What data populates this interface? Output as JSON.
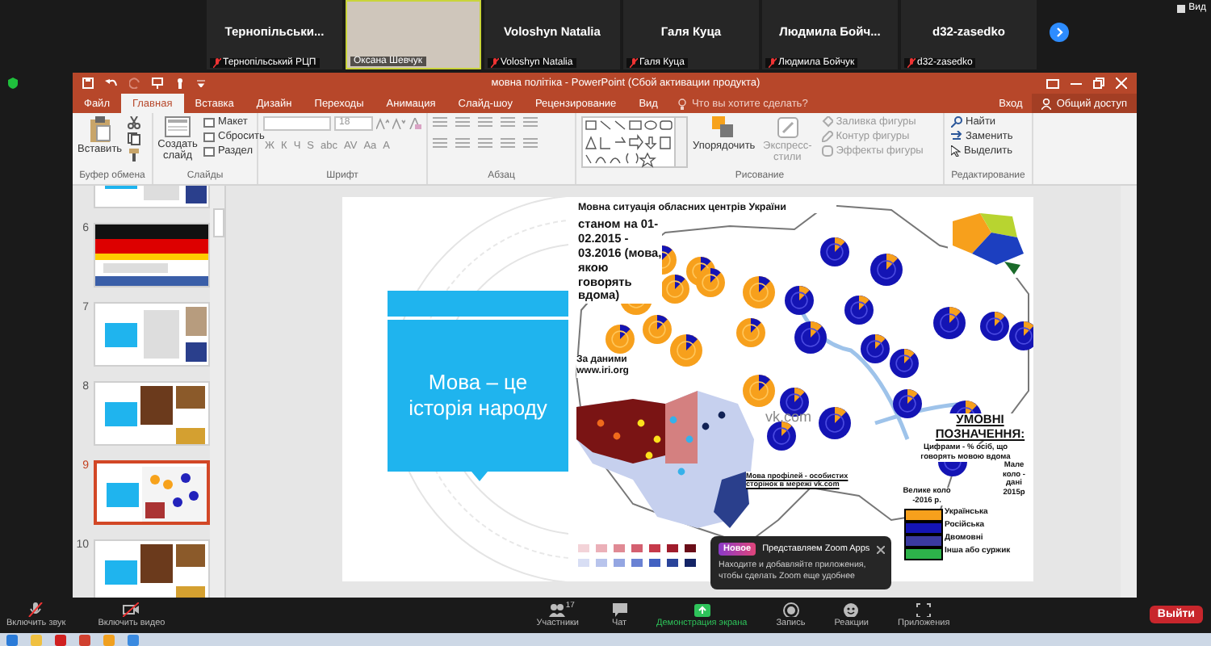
{
  "gallery": {
    "tiles": [
      {
        "kind": "name",
        "name": "Тернопільськи...",
        "label": "Тернопільський РЦП",
        "muted": true,
        "speaking": false
      },
      {
        "kind": "video",
        "label": "Оксана Шевчук",
        "muted": false,
        "speaking": true
      },
      {
        "kind": "name",
        "name": "Voloshyn Natalia",
        "label": "Voloshyn Natalia",
        "muted": true,
        "speaking": false
      },
      {
        "kind": "name",
        "name": "Галя  Куца",
        "label": "Галя Куца",
        "muted": true,
        "speaking": false
      },
      {
        "kind": "name",
        "name": "Людмила  Бойч...",
        "label": "Людмила Бойчук",
        "muted": true,
        "speaking": false
      },
      {
        "kind": "name",
        "name": "d32-zasedko",
        "label": "d32-zasedko",
        "muted": true,
        "speaking": false
      }
    ],
    "view_button": "Вид"
  },
  "app": {
    "title": "мовна політіка - PowerPoint (Сбой активации продукта)",
    "tabs": [
      {
        "label": "Файл",
        "selected": false
      },
      {
        "label": "Главная",
        "selected": true
      },
      {
        "label": "Вставка",
        "selected": false
      },
      {
        "label": "Дизайн",
        "selected": false
      },
      {
        "label": "Переходы",
        "selected": false
      },
      {
        "label": "Анимация",
        "selected": false
      },
      {
        "label": "Слайд-шоу",
        "selected": false
      },
      {
        "label": "Рецензирование",
        "selected": false
      },
      {
        "label": "Вид",
        "selected": false
      }
    ],
    "tell_me": "Что вы хотите сделать?",
    "sign_in": "Вход",
    "share": "Общий доступ",
    "ribbon": {
      "clipboard": {
        "label": "Буфер обмена",
        "paste": "Вставить"
      },
      "slides": {
        "label": "Слайды",
        "new_slide": "Создать слайд",
        "layout": "Макет",
        "reset": "Сбросить",
        "section": "Раздел"
      },
      "font": {
        "label": "Шрифт",
        "size": "18",
        "formats": [
          "Ж",
          "К",
          "Ч",
          "S",
          "abc",
          "AV",
          "Aa",
          "A"
        ]
      },
      "paragraph": {
        "label": "Абзац"
      },
      "drawing": {
        "label": "Рисование",
        "arrange": "Упорядочить",
        "styles": "Экспресс-стили",
        "fill": "Заливка фигуры",
        "outline": "Контур фигуры",
        "effects": "Эффекты фигуры"
      },
      "editing": {
        "label": "Редактирование",
        "find": "Найти",
        "replace": "Заменить",
        "select": "Выделить"
      }
    },
    "slides": [
      {
        "number": "6",
        "selected": false,
        "kind": "flag"
      },
      {
        "number": "7",
        "selected": false,
        "kind": "text"
      },
      {
        "number": "8",
        "selected": false,
        "kind": "photo"
      },
      {
        "number": "9",
        "selected": true,
        "kind": "map"
      },
      {
        "number": "10",
        "selected": false,
        "kind": "photo"
      }
    ],
    "slide": {
      "callout": "Мова – це історія народу",
      "map": {
        "title": "Мовна ситуація обласних центрів України",
        "subtitle": "станом на 01-02.2015 - 03.2016 (мова, якою говорять вдома)",
        "source": "За даними www.iri.org",
        "vk": "vk.com",
        "vk_note": "Мова профілей - особистих сторінок в мережі vk.com",
        "legend_title": "УМОВНІ ПОЗНАЧЕННЯ:",
        "legend_note": "Цифрами - % осіб, що говорять мовою вдома",
        "small_circle": "Мале коло - дані 2015р",
        "big_circle": "Велике коло -2016 р.",
        "legend": [
          {
            "label": "Українська",
            "color": "#f7a01c"
          },
          {
            "label": "Російська",
            "color": "#1414b4"
          },
          {
            "label": "Двомовні",
            "color": "#3a3aa0"
          },
          {
            "label": "Інша або суржик",
            "color": "#2db34a"
          }
        ]
      }
    }
  },
  "popup": {
    "badge": "Новое",
    "title": "Представляем Zoom Apps",
    "body": "Находите и добавляйте приложения, чтобы сделать Zoom еще удобнее"
  },
  "toolbar": {
    "items": [
      {
        "kind": "mic",
        "label": "Включить звук"
      },
      {
        "kind": "video",
        "label": "Включить видео"
      },
      {
        "kind": "participants",
        "label": "Участники",
        "count": "17"
      },
      {
        "kind": "chat",
        "label": "Чат"
      },
      {
        "kind": "share",
        "label": "Демонстрация экрана"
      },
      {
        "kind": "record",
        "label": "Запись"
      },
      {
        "kind": "reactions",
        "label": "Реакции"
      },
      {
        "kind": "apps",
        "label": "Приложения"
      }
    ],
    "leave": "Выйти"
  }
}
